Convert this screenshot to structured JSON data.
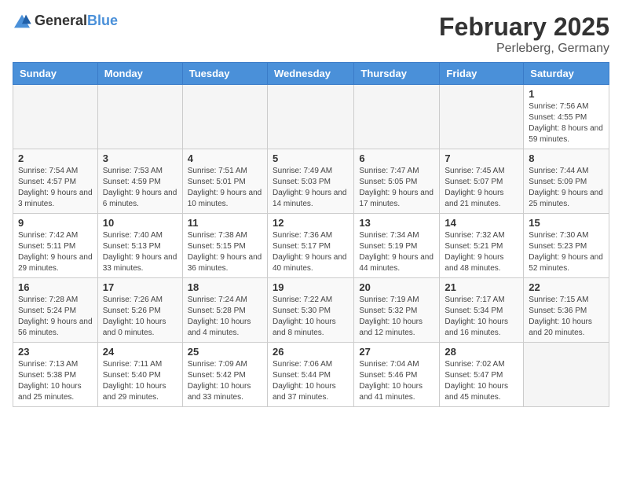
{
  "header": {
    "logo_general": "General",
    "logo_blue": "Blue",
    "month_title": "February 2025",
    "location": "Perleberg, Germany"
  },
  "weekdays": [
    "Sunday",
    "Monday",
    "Tuesday",
    "Wednesday",
    "Thursday",
    "Friday",
    "Saturday"
  ],
  "weeks": [
    [
      {
        "day": "",
        "info": ""
      },
      {
        "day": "",
        "info": ""
      },
      {
        "day": "",
        "info": ""
      },
      {
        "day": "",
        "info": ""
      },
      {
        "day": "",
        "info": ""
      },
      {
        "day": "",
        "info": ""
      },
      {
        "day": "1",
        "info": "Sunrise: 7:56 AM\nSunset: 4:55 PM\nDaylight: 8 hours and 59 minutes."
      }
    ],
    [
      {
        "day": "2",
        "info": "Sunrise: 7:54 AM\nSunset: 4:57 PM\nDaylight: 9 hours and 3 minutes."
      },
      {
        "day": "3",
        "info": "Sunrise: 7:53 AM\nSunset: 4:59 PM\nDaylight: 9 hours and 6 minutes."
      },
      {
        "day": "4",
        "info": "Sunrise: 7:51 AM\nSunset: 5:01 PM\nDaylight: 9 hours and 10 minutes."
      },
      {
        "day": "5",
        "info": "Sunrise: 7:49 AM\nSunset: 5:03 PM\nDaylight: 9 hours and 14 minutes."
      },
      {
        "day": "6",
        "info": "Sunrise: 7:47 AM\nSunset: 5:05 PM\nDaylight: 9 hours and 17 minutes."
      },
      {
        "day": "7",
        "info": "Sunrise: 7:45 AM\nSunset: 5:07 PM\nDaylight: 9 hours and 21 minutes."
      },
      {
        "day": "8",
        "info": "Sunrise: 7:44 AM\nSunset: 5:09 PM\nDaylight: 9 hours and 25 minutes."
      }
    ],
    [
      {
        "day": "9",
        "info": "Sunrise: 7:42 AM\nSunset: 5:11 PM\nDaylight: 9 hours and 29 minutes."
      },
      {
        "day": "10",
        "info": "Sunrise: 7:40 AM\nSunset: 5:13 PM\nDaylight: 9 hours and 33 minutes."
      },
      {
        "day": "11",
        "info": "Sunrise: 7:38 AM\nSunset: 5:15 PM\nDaylight: 9 hours and 36 minutes."
      },
      {
        "day": "12",
        "info": "Sunrise: 7:36 AM\nSunset: 5:17 PM\nDaylight: 9 hours and 40 minutes."
      },
      {
        "day": "13",
        "info": "Sunrise: 7:34 AM\nSunset: 5:19 PM\nDaylight: 9 hours and 44 minutes."
      },
      {
        "day": "14",
        "info": "Sunrise: 7:32 AM\nSunset: 5:21 PM\nDaylight: 9 hours and 48 minutes."
      },
      {
        "day": "15",
        "info": "Sunrise: 7:30 AM\nSunset: 5:23 PM\nDaylight: 9 hours and 52 minutes."
      }
    ],
    [
      {
        "day": "16",
        "info": "Sunrise: 7:28 AM\nSunset: 5:24 PM\nDaylight: 9 hours and 56 minutes."
      },
      {
        "day": "17",
        "info": "Sunrise: 7:26 AM\nSunset: 5:26 PM\nDaylight: 10 hours and 0 minutes."
      },
      {
        "day": "18",
        "info": "Sunrise: 7:24 AM\nSunset: 5:28 PM\nDaylight: 10 hours and 4 minutes."
      },
      {
        "day": "19",
        "info": "Sunrise: 7:22 AM\nSunset: 5:30 PM\nDaylight: 10 hours and 8 minutes."
      },
      {
        "day": "20",
        "info": "Sunrise: 7:19 AM\nSunset: 5:32 PM\nDaylight: 10 hours and 12 minutes."
      },
      {
        "day": "21",
        "info": "Sunrise: 7:17 AM\nSunset: 5:34 PM\nDaylight: 10 hours and 16 minutes."
      },
      {
        "day": "22",
        "info": "Sunrise: 7:15 AM\nSunset: 5:36 PM\nDaylight: 10 hours and 20 minutes."
      }
    ],
    [
      {
        "day": "23",
        "info": "Sunrise: 7:13 AM\nSunset: 5:38 PM\nDaylight: 10 hours and 25 minutes."
      },
      {
        "day": "24",
        "info": "Sunrise: 7:11 AM\nSunset: 5:40 PM\nDaylight: 10 hours and 29 minutes."
      },
      {
        "day": "25",
        "info": "Sunrise: 7:09 AM\nSunset: 5:42 PM\nDaylight: 10 hours and 33 minutes."
      },
      {
        "day": "26",
        "info": "Sunrise: 7:06 AM\nSunset: 5:44 PM\nDaylight: 10 hours and 37 minutes."
      },
      {
        "day": "27",
        "info": "Sunrise: 7:04 AM\nSunset: 5:46 PM\nDaylight: 10 hours and 41 minutes."
      },
      {
        "day": "28",
        "info": "Sunrise: 7:02 AM\nSunset: 5:47 PM\nDaylight: 10 hours and 45 minutes."
      },
      {
        "day": "",
        "info": ""
      }
    ]
  ]
}
